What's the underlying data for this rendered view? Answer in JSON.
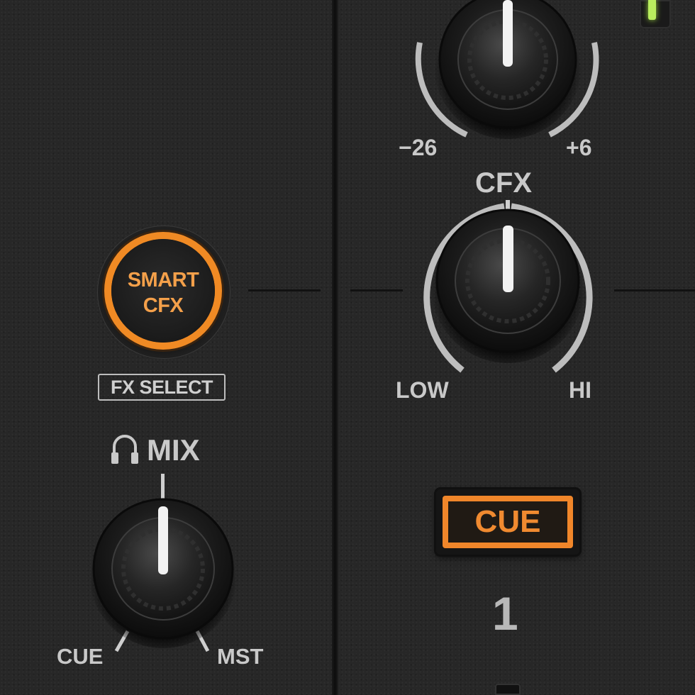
{
  "colors": {
    "accent": "#f08a24",
    "label": "#c9c9c9",
    "panel": "#272727",
    "meter": "#b8f05a"
  },
  "trim": {
    "min_label": "−26",
    "max_label": "+6"
  },
  "cfx": {
    "title": "CFX",
    "low_label": "LOW",
    "hi_label": "HI"
  },
  "smart_cfx": {
    "line1": "SMART",
    "line2": "CFX"
  },
  "fx_select": {
    "label": "FX SELECT"
  },
  "headphones_mix": {
    "icon": "headphones-icon",
    "title": "MIX",
    "left_label": "CUE",
    "right_label": "MST"
  },
  "channel_cue": {
    "label": "CUE"
  },
  "channel": {
    "number": "1"
  }
}
